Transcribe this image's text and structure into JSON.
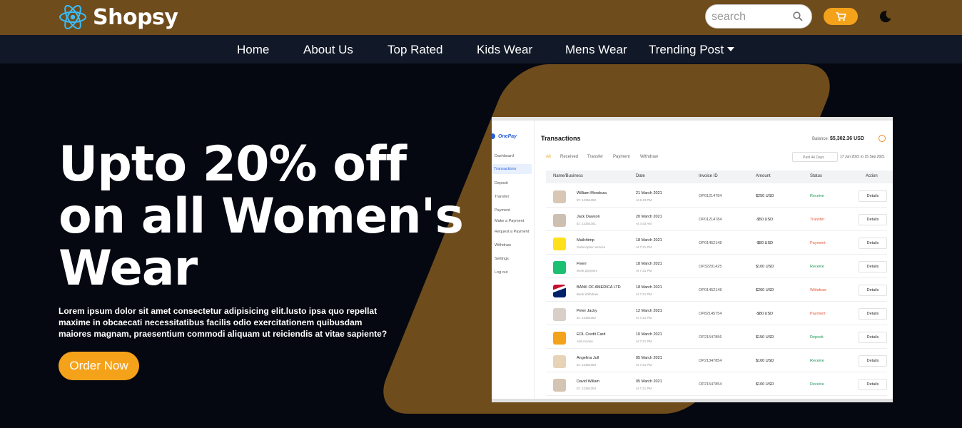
{
  "brand": {
    "name": "Shopsy"
  },
  "search": {
    "placeholder": "search"
  },
  "nav": {
    "items": [
      "Home",
      "About Us",
      "Top Rated",
      "Kids Wear",
      "Mens Wear",
      "Trending Post"
    ]
  },
  "hero": {
    "title": "Upto 20% off on all Women's Wear",
    "text": "Lorem ipsum dolor sit amet consectetur adipisicing elit.lusto ipsa quo repellat maxime in obcaecati necessitatibus facilis odio exercitationem quibusdam maiores magnam, praesentium commodi aliquam ut reiciendis at vitae sapiente?",
    "cta": "Order Now"
  },
  "colors": {
    "topbar": "#6f4c1c",
    "nav": "#111827",
    "accent": "#f5a21b",
    "background": "#050810"
  },
  "dashboard": {
    "logo": "OnePay",
    "title": "Transactions",
    "balance_label": "Balance:",
    "balance_value": "$5,302.36 USD",
    "sidebar": [
      "Dashboard",
      "Transactions",
      "Deposit",
      "Transfer",
      "Payment",
      "Make a Payment",
      "Request a Payment",
      "Withdraw",
      "Settings",
      "Log out"
    ],
    "tabs": [
      "All",
      "Received",
      "Transfer",
      "Payment",
      "Withdraw"
    ],
    "filter": "Past 44 Days",
    "date_from": "17 Jun 2021",
    "date_sep": "to",
    "date_to": "15 Sep 2021",
    "columns": [
      "Name/Business",
      "Date",
      "Invoice ID",
      "Amount",
      "Status",
      "Action"
    ],
    "rows": [
      {
        "name": "William Mendoza",
        "sub": "ID: 12354350",
        "date": "21 March 2021",
        "time": "At 6:43 PM",
        "invoice": "OP01214784",
        "amount": "$250 USD",
        "status": "Receive",
        "action": "Details"
      },
      {
        "name": "Jack Dawson",
        "sub": "ID: 12354351",
        "date": "20 March 2021",
        "time": "At 4:43 AM",
        "invoice": "OP01214784",
        "amount": "-$50 USD",
        "status": "Transfer",
        "action": "Details"
      },
      {
        "name": "Mailchimp",
        "sub": "Subscription service",
        "date": "18 March 2021",
        "time": "At 7:21 PM",
        "invoice": "OP01452148",
        "amount": "-$80 USD",
        "status": "Payment",
        "action": "Details"
      },
      {
        "name": "Fiverr",
        "sub": "Work payment",
        "date": "18 March 2021",
        "time": "At 7:21 PM",
        "invoice": "OP32201425",
        "amount": "$100 USD",
        "status": "Receive",
        "action": "Details"
      },
      {
        "name": "BANK OF AMERICA LTD",
        "sub": "Bank Withdraw",
        "date": "18 March 2021",
        "time": "At 7:21 PM",
        "invoice": "OP01452148",
        "amount": "$200 USD",
        "status": "Withdraw",
        "action": "Details"
      },
      {
        "name": "Peter Jacky",
        "sub": "ID: 12354352",
        "date": "12 March 2021",
        "time": "At 7:21 PM",
        "invoice": "OP82145754",
        "amount": "-$80 USD",
        "status": "Payment",
        "action": "Details"
      },
      {
        "name": "EOL Credit Card",
        "sub": "Add money",
        "date": "10 March 2021",
        "time": "At 7:21 PM",
        "invoice": "OP21547856",
        "amount": "$150 USD",
        "status": "Deposit",
        "action": "Details"
      },
      {
        "name": "Angelina Jull",
        "sub": "ID: 12354353",
        "date": "05 March 2021",
        "time": "At 7:21 PM",
        "invoice": "OP21347854",
        "amount": "$100 USD",
        "status": "Receive",
        "action": "Details"
      },
      {
        "name": "David Willam",
        "sub": "ID: 12354353",
        "date": "05 March 2021",
        "time": "At 7:21 PM",
        "invoice": "OP21547854",
        "amount": "$100 USD",
        "status": "Receive",
        "action": "Details"
      }
    ]
  }
}
